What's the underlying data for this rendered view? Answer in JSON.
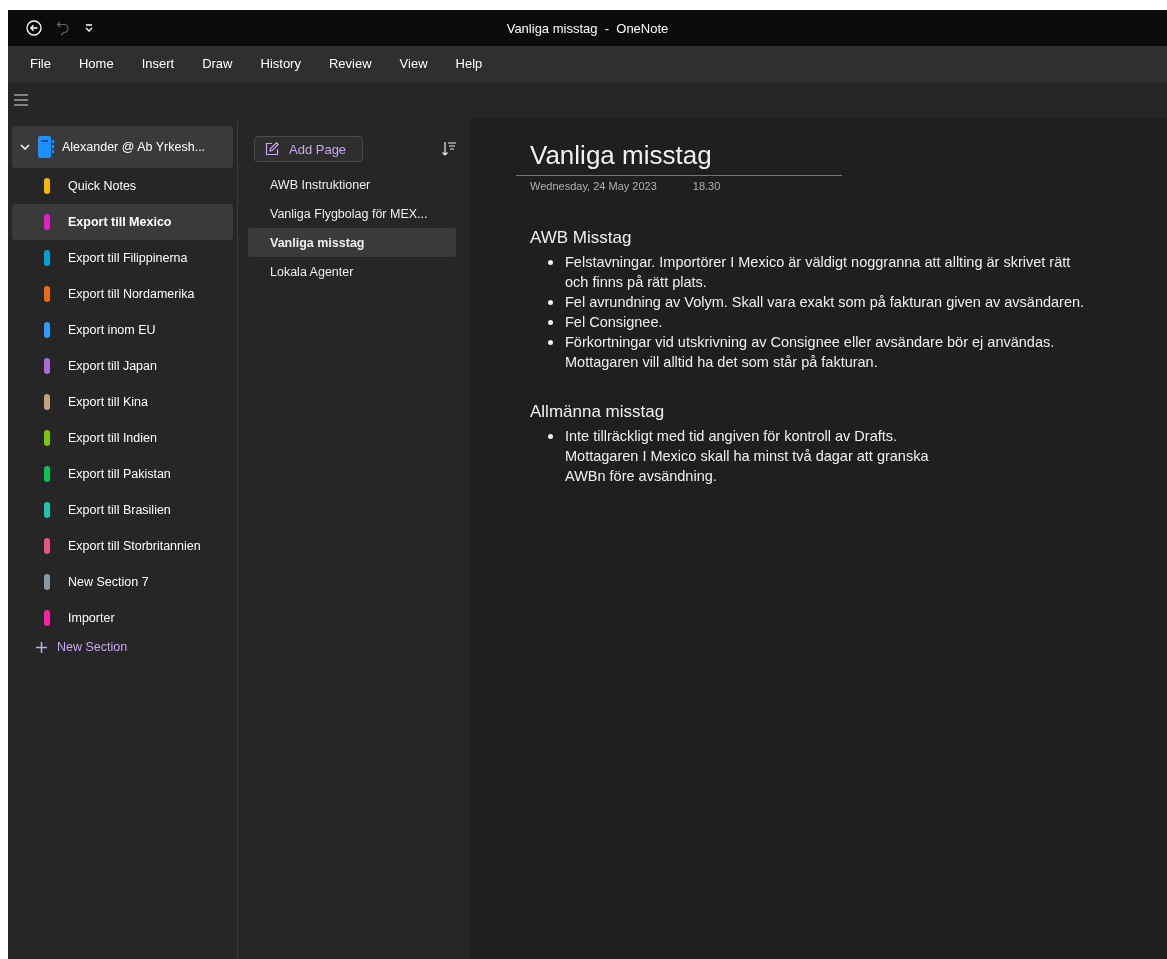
{
  "window": {
    "title": "Vanliga misstag  -  OneNote"
  },
  "menu": [
    {
      "label": "File",
      "selected": false
    },
    {
      "label": "Home",
      "selected": false
    },
    {
      "label": "Insert",
      "selected": false
    },
    {
      "label": "Draw",
      "selected": false
    },
    {
      "label": "History",
      "selected": false
    },
    {
      "label": "Review",
      "selected": false
    },
    {
      "label": "View",
      "selected": false
    },
    {
      "label": "Help",
      "selected": false
    }
  ],
  "notebook": {
    "name": "Alexander @ Ab Yrkesh...",
    "expanded": true
  },
  "sections": [
    {
      "label": "Quick Notes",
      "color": "#f5b800",
      "selected": false
    },
    {
      "label": "Export till Mexico",
      "color": "#e91ec8",
      "selected": true
    },
    {
      "label": "Export till Filippinerna",
      "color": "#00a2d6",
      "selected": false
    },
    {
      "label": "Export till Nordamerika",
      "color": "#f06a12",
      "selected": false
    },
    {
      "label": "Export inom EU",
      "color": "#2e9cff",
      "selected": false
    },
    {
      "label": "Export till Japan",
      "color": "#b06ad6",
      "selected": false
    },
    {
      "label": "Export till Kina",
      "color": "#c6a27a",
      "selected": false
    },
    {
      "label": "Export till Indien",
      "color": "#7ac70a",
      "selected": false
    },
    {
      "label": "Export till Pakistan",
      "color": "#00c853",
      "selected": false
    },
    {
      "label": "Export till Brasilien",
      "color": "#1fc4b0",
      "selected": false
    },
    {
      "label": "Export till Storbritannien",
      "color": "#e8577a",
      "selected": false
    },
    {
      "label": "New Section 7",
      "color": "#8a9aa5",
      "selected": false
    },
    {
      "label": "Importer",
      "color": "#ff1fa0",
      "selected": false
    }
  ],
  "new_section": "New Section",
  "add_page": "Add Page",
  "pages": [
    {
      "label": "AWB Instruktioner",
      "selected": false
    },
    {
      "label": "Vanliga Flygbolag för MEX...",
      "selected": false
    },
    {
      "label": "Vanliga misstag",
      "selected": true
    },
    {
      "label": "Lokala Agenter",
      "selected": false
    }
  ],
  "note": {
    "title": "Vanliga misstag",
    "date": "Wednesday, 24 May 2023",
    "time": "18.30",
    "blocks": [
      {
        "heading": "AWB Misstag",
        "bullets": [
          {
            "lines": [
              "Felstavningar. Importörer I Mexico är väldigt noggranna att allting är skrivet rätt",
              "och finns på rätt plats."
            ]
          },
          {
            "lines": [
              "Fel avrundning av Volym. Skall vara exakt som på fakturan given av avsändaren."
            ]
          },
          {
            "lines": [
              "Fel Consignee."
            ]
          },
          {
            "lines": [
              "Förkortningar vid utskrivning av Consignee eller avsändare bör ej användas.",
              "Mottagaren vill alltid ha det som står på fakturan."
            ]
          }
        ]
      },
      {
        "heading": "Allmänna misstag",
        "bullets": [
          {
            "lines": [
              "Inte tillräckligt med tid angiven för kontroll av Drafts.",
              "Mottagaren I Mexico skall ha minst två dagar att granska",
              "AWBn före avsändning."
            ]
          }
        ]
      }
    ]
  }
}
